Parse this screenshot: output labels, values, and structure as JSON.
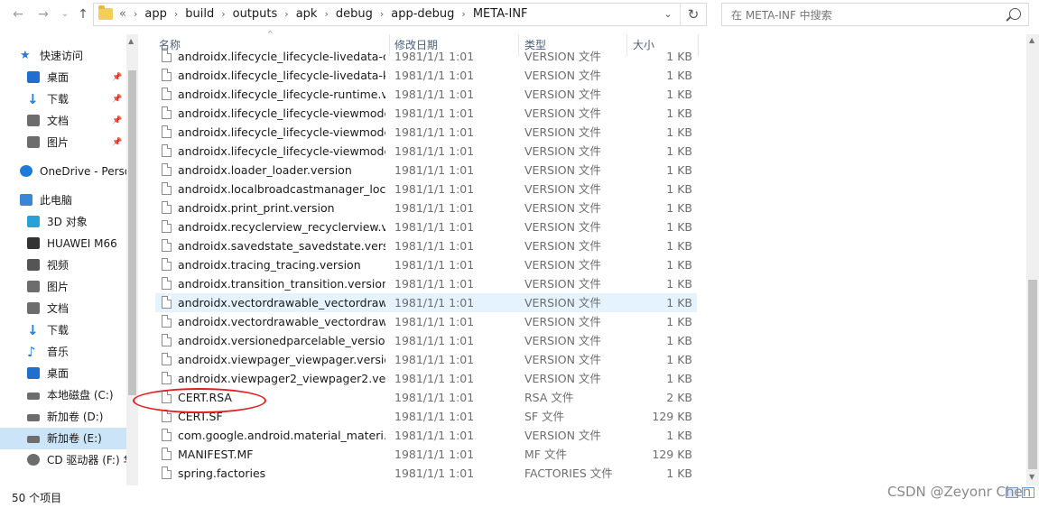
{
  "address_bar": {
    "overflow": "«",
    "crumbs": [
      "app",
      "build",
      "outputs",
      "apk",
      "debug",
      "app-debug",
      "META-INF"
    ],
    "search_placeholder": "在 META-INF 中搜索"
  },
  "nav": {
    "items": [
      {
        "label": "快速访问",
        "icon": "star-icon",
        "color": "#2b79d0"
      },
      {
        "label": "桌面",
        "icon": "desktop-icon",
        "color": "#1e6fd0",
        "pinned": true
      },
      {
        "label": "下载",
        "icon": "download-icon",
        "color": "#2b79d0",
        "pinned": true
      },
      {
        "label": "文档",
        "icon": "documents-icon",
        "color": "#6d6d6d",
        "pinned": true
      },
      {
        "label": "图片",
        "icon": "pictures-icon",
        "color": "#6d6d6d",
        "pinned": true
      },
      {
        "label": "OneDrive - Perso",
        "icon": "onedrive-icon",
        "color": "#1f7bd8"
      },
      {
        "label": "此电脑",
        "icon": "computer-icon",
        "color": "#3a86d6"
      },
      {
        "label": "3D 对象",
        "icon": "3d-objects-icon",
        "color": "#2aa0d8"
      },
      {
        "label": "HUAWEI M66",
        "icon": "phone-icon",
        "color": "#333333"
      },
      {
        "label": "视频",
        "icon": "videos-icon",
        "color": "#555555"
      },
      {
        "label": "图片",
        "icon": "pictures-icon",
        "color": "#6d6d6d"
      },
      {
        "label": "文档",
        "icon": "documents-icon",
        "color": "#6d6d6d"
      },
      {
        "label": "下载",
        "icon": "download-icon",
        "color": "#2b79d0"
      },
      {
        "label": "音乐",
        "icon": "music-icon",
        "color": "#2b79d0"
      },
      {
        "label": "桌面",
        "icon": "desktop-icon",
        "color": "#1e6fd0"
      },
      {
        "label": "本地磁盘 (C:)",
        "icon": "drive-icon",
        "color": "#6d6d6d"
      },
      {
        "label": "新加卷 (D:)",
        "icon": "drive-icon",
        "color": "#6d6d6d"
      },
      {
        "label": "新加卷 (E:)",
        "icon": "drive-icon",
        "color": "#6d6d6d",
        "selected": true
      },
      {
        "label": "CD 驱动器 (F:) 华",
        "icon": "cd-drive-icon",
        "color": "#6d6d6d"
      }
    ]
  },
  "columns": {
    "name": "名称",
    "date": "修改日期",
    "type": "类型",
    "size": "大小"
  },
  "files": [
    {
      "name": "androidx.lifecycle_lifecycle-livedata-c...",
      "date": "1981/1/1 1:01",
      "type": "VERSION 文件",
      "size": "1 KB"
    },
    {
      "name": "androidx.lifecycle_lifecycle-livedata-kt...",
      "date": "1981/1/1 1:01",
      "type": "VERSION 文件",
      "size": "1 KB"
    },
    {
      "name": "androidx.lifecycle_lifecycle-runtime.ve...",
      "date": "1981/1/1 1:01",
      "type": "VERSION 文件",
      "size": "1 KB"
    },
    {
      "name": "androidx.lifecycle_lifecycle-viewmodel...",
      "date": "1981/1/1 1:01",
      "type": "VERSION 文件",
      "size": "1 KB"
    },
    {
      "name": "androidx.lifecycle_lifecycle-viewmodel...",
      "date": "1981/1/1 1:01",
      "type": "VERSION 文件",
      "size": "1 KB"
    },
    {
      "name": "androidx.lifecycle_lifecycle-viewmodel...",
      "date": "1981/1/1 1:01",
      "type": "VERSION 文件",
      "size": "1 KB"
    },
    {
      "name": "androidx.loader_loader.version",
      "date": "1981/1/1 1:01",
      "type": "VERSION 文件",
      "size": "1 KB"
    },
    {
      "name": "androidx.localbroadcastmanager_loc...",
      "date": "1981/1/1 1:01",
      "type": "VERSION 文件",
      "size": "1 KB"
    },
    {
      "name": "androidx.print_print.version",
      "date": "1981/1/1 1:01",
      "type": "VERSION 文件",
      "size": "1 KB"
    },
    {
      "name": "androidx.recyclerview_recyclerview.ve...",
      "date": "1981/1/1 1:01",
      "type": "VERSION 文件",
      "size": "1 KB"
    },
    {
      "name": "androidx.savedstate_savedstate.versi...",
      "date": "1981/1/1 1:01",
      "type": "VERSION 文件",
      "size": "1 KB"
    },
    {
      "name": "androidx.tracing_tracing.version",
      "date": "1981/1/1 1:01",
      "type": "VERSION 文件",
      "size": "1 KB"
    },
    {
      "name": "androidx.transition_transition.version",
      "date": "1981/1/1 1:01",
      "type": "VERSION 文件",
      "size": "1 KB"
    },
    {
      "name": "androidx.vectordrawable_vectordraw...",
      "date": "1981/1/1 1:01",
      "type": "VERSION 文件",
      "size": "1 KB",
      "hover": true
    },
    {
      "name": "androidx.vectordrawable_vectordraw...",
      "date": "1981/1/1 1:01",
      "type": "VERSION 文件",
      "size": "1 KB"
    },
    {
      "name": "androidx.versionedparcelable_versio...",
      "date": "1981/1/1 1:01",
      "type": "VERSION 文件",
      "size": "1 KB"
    },
    {
      "name": "androidx.viewpager_viewpager.version",
      "date": "1981/1/1 1:01",
      "type": "VERSION 文件",
      "size": "1 KB"
    },
    {
      "name": "androidx.viewpager2_viewpager2.ver...",
      "date": "1981/1/1 1:01",
      "type": "VERSION 文件",
      "size": "1 KB"
    },
    {
      "name": "CERT.RSA",
      "date": "1981/1/1 1:01",
      "type": "RSA 文件",
      "size": "2 KB"
    },
    {
      "name": "CERT.SF",
      "date": "1981/1/1 1:01",
      "type": "SF 文件",
      "size": "129 KB"
    },
    {
      "name": "com.google.android.material_materi...",
      "date": "1981/1/1 1:01",
      "type": "VERSION 文件",
      "size": "1 KB"
    },
    {
      "name": "MANIFEST.MF",
      "date": "1981/1/1 1:01",
      "type": "MF 文件",
      "size": "129 KB"
    },
    {
      "name": "spring.factories",
      "date": "1981/1/1 1:01",
      "type": "FACTORIES 文件",
      "size": "1 KB"
    }
  ],
  "status": {
    "item_count": "50 个项目"
  },
  "watermark": "CSDN @Zeyonr Chen",
  "colors": {
    "selected": "#cce4f7",
    "hover": "#e5f3ff",
    "annotation": "#e02020"
  }
}
